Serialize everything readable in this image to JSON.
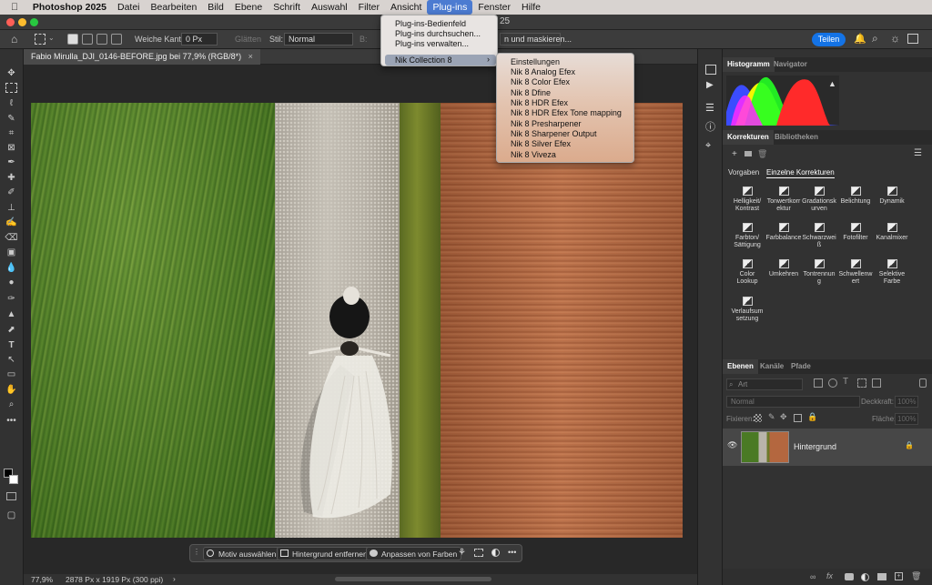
{
  "menubar": {
    "app_name": "Photoshop 2025",
    "items": [
      "Datei",
      "Bearbeiten",
      "Bild",
      "Ebene",
      "Schrift",
      "Auswahl",
      "Filter",
      "Ansicht",
      "Plug-ins",
      "Fenster",
      "Hilfe"
    ],
    "active_item": "Plug-ins"
  },
  "titlebar": {
    "title_fragment": "25"
  },
  "options": {
    "weiche_kante_label": "Weiche Kante:",
    "weiche_kante_value": "0 Px",
    "glaetten_label": "Glätten",
    "stil_label": "Stil:",
    "stil_value": "Normal",
    "b_label": "B:",
    "select_mask_label": "n und maskieren...",
    "share_label": "Teilen"
  },
  "plugins_menu": {
    "items": [
      "Plug-ins-Bedienfeld",
      "Plug-ins durchsuchen...",
      "Plug-ins verwalten..."
    ],
    "submenu_label": "Nik Collection 8",
    "submenu_arrow": "›"
  },
  "nik_submenu": {
    "items": [
      "Einstellungen",
      "Nik 8 Analog Efex",
      "Nik 8 Color Efex",
      "Nik 8 Dfine",
      "Nik 8 HDR Efex",
      "Nik 8 HDR Efex Tone mapping",
      "Nik 8 Presharpener",
      "Nik 8 Sharpener Output",
      "Nik 8 Silver Efex",
      "Nik 8 Viveza"
    ]
  },
  "document": {
    "tab_title": "Fabio Mirulla_DJI_0146-BEFORE.jpg bei 77,9% (RGB/8*)",
    "close_glyph": "×"
  },
  "taskbar": {
    "items": [
      "Motiv auswählen",
      "Hintergrund entfernen",
      "Anpassen von Farben"
    ],
    "more": "•••"
  },
  "status": {
    "zoom": "77,9%",
    "info": "2878 Px x 1919 Px (300 ppi)",
    "arrow": "›"
  },
  "panels": {
    "histogram_tabs": [
      "Histogramm",
      "Navigator"
    ],
    "warning_glyph": "▲",
    "korrekturen_tabs": [
      "Korrekturen",
      "Bibliotheken"
    ],
    "korrekturen_subtabs": [
      "Vorgaben",
      "Einzelne Korrekturen"
    ],
    "adjustments": [
      "Helligkeit/ Kontrast",
      "Tonwertkorr ektur",
      "Gradationsk urven",
      "Belichtung",
      "Dynamik",
      "Farbton/ Sättigung",
      "Farbbalance",
      "Schwarzwei ß",
      "Fotofilter",
      "Kanalmixer",
      "Color Lookup",
      "Umkehren",
      "Tontrennun g",
      "Schwellenw ert",
      "Selektive Farbe",
      "Verlaufsum setzung"
    ],
    "ebenen_tabs": [
      "Ebenen",
      "Kanäle",
      "Pfade"
    ],
    "filter_placeholder": "Art",
    "blend_mode": "Normal",
    "deckkraft_label": "Deckkraft:",
    "deckkraft_value": "100%",
    "fixieren_label": "Fixieren:",
    "flaeche_label": "Fläche:",
    "flaeche_value": "100%",
    "layer_name": "Hintergrund",
    "layer_eye": "👁",
    "layer_lock": "🔒"
  },
  "colors": {
    "accent": "#1473e6",
    "menu_highlight": "#4c7bd1",
    "grass": "#4a7a24",
    "path": "#b9b4ab",
    "soil": "#b4673f"
  },
  "histogram": {
    "channels": [
      {
        "name": "red",
        "color": "#ff2a2a"
      },
      {
        "name": "green",
        "color": "#22ff22"
      },
      {
        "name": "blue",
        "color": "#3b4cff"
      },
      {
        "name": "yellow",
        "color": "#f5f500"
      },
      {
        "name": "magenta",
        "color": "#ff2aff"
      }
    ]
  }
}
